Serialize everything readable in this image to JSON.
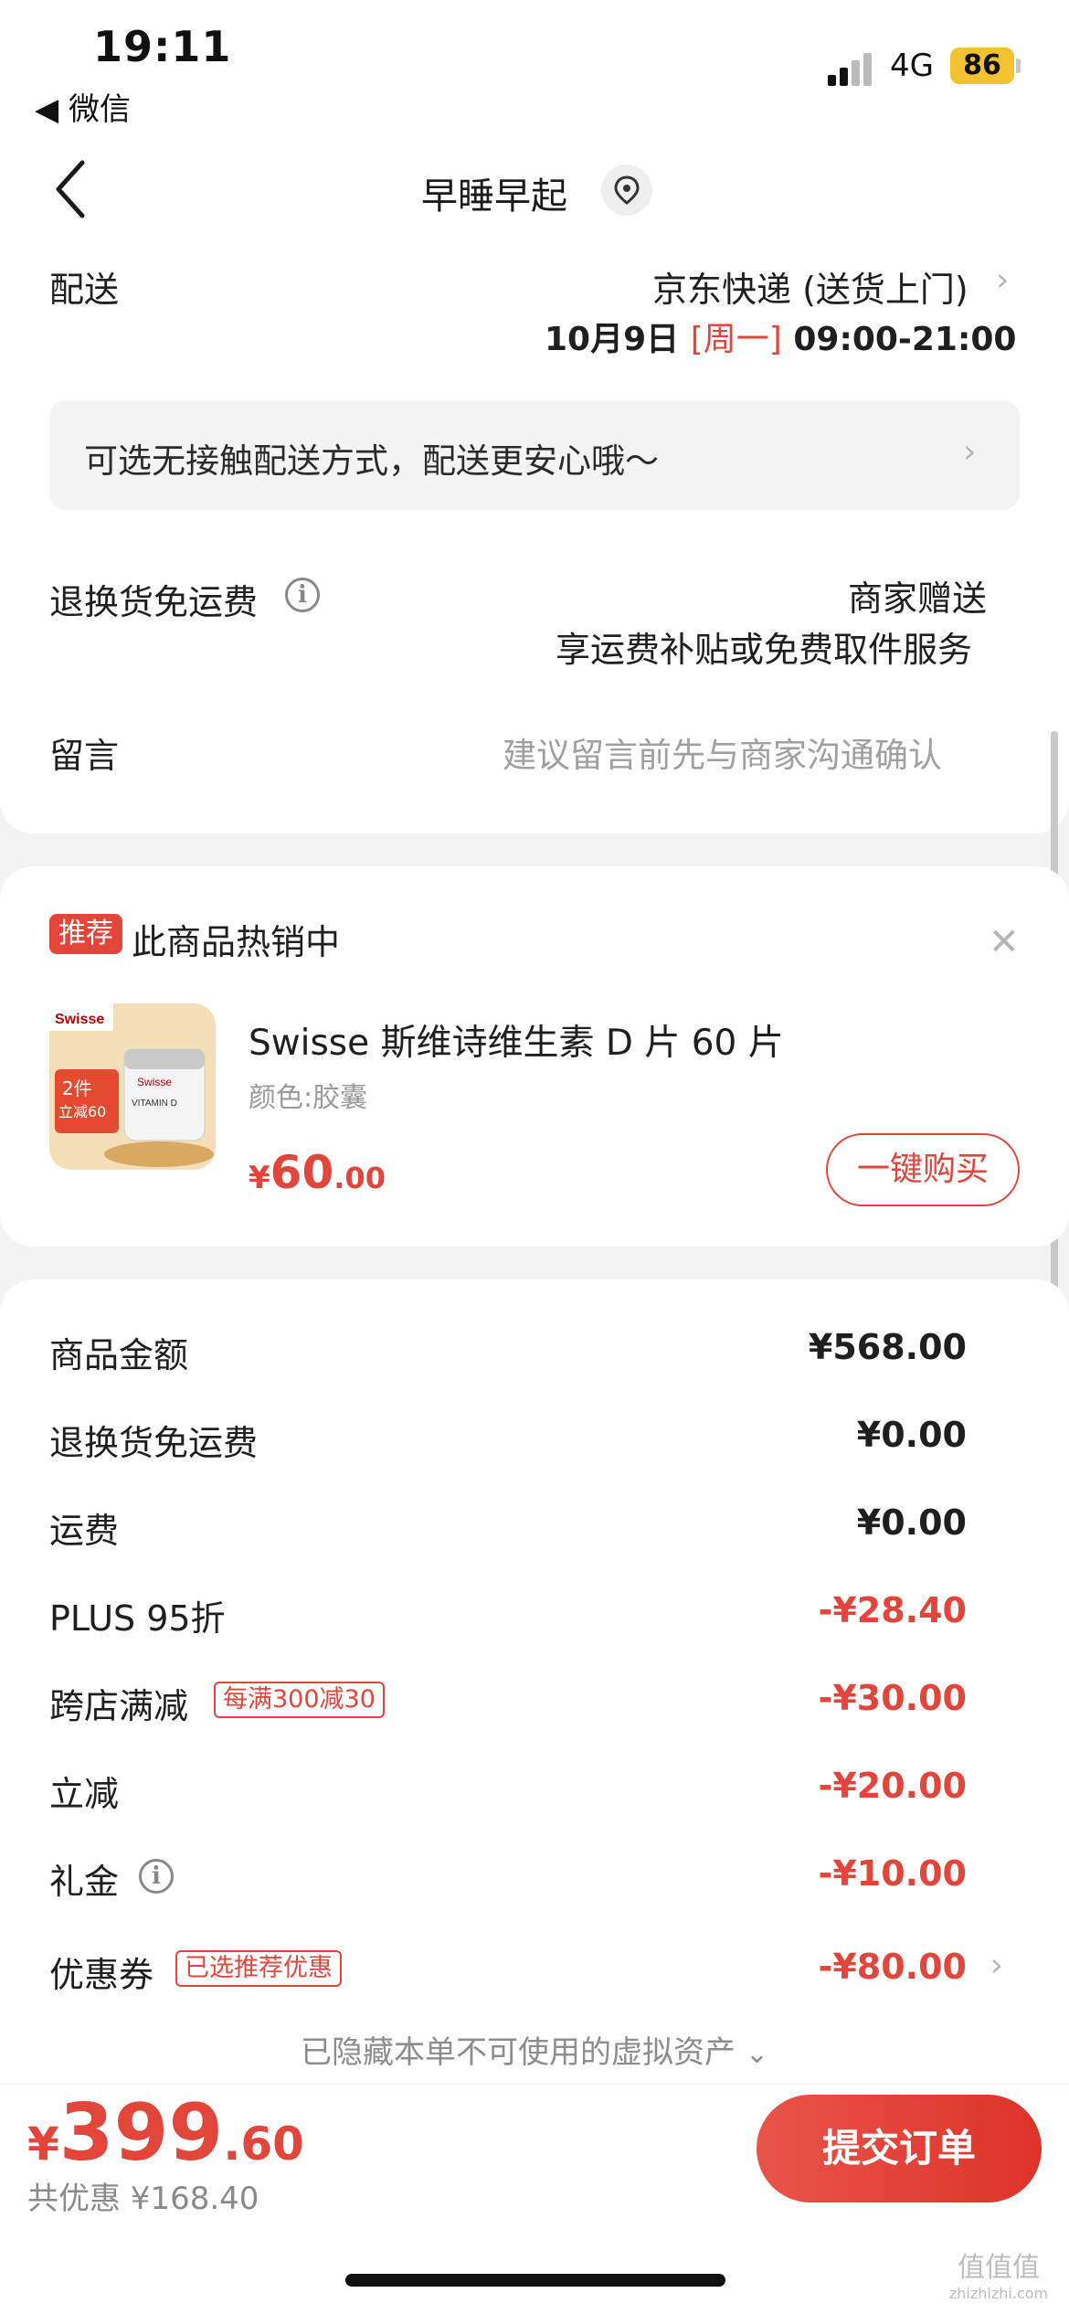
{
  "status_bar": {
    "time": "19:11",
    "back_app": "◀ 微信",
    "network": "4G",
    "battery": "86"
  },
  "header": {
    "title": "早睡早起"
  },
  "delivery": {
    "label": "配送",
    "method": "京东快递 (送货上门)",
    "date": "10月9日",
    "weekday": "[周一]",
    "time_range": "09:00-21:00",
    "tip": "可选无接触配送方式，配送更安心哦～"
  },
  "return_shipping": {
    "label": "退换货免运费",
    "value_line1": "商家赠送",
    "value_line2": "享运费补贴或免费取件服务"
  },
  "message": {
    "label": "留言",
    "placeholder": "建议留言前先与商家沟通确认"
  },
  "recommend": {
    "tag": "推荐",
    "title": "此商品热销中",
    "product_name": "Swisse 斯维诗维生素 D 片 60 片",
    "spec": "颜色:胶囊",
    "price_symbol": "¥",
    "price_int": "60",
    "price_dec": ".00",
    "buy_label": "一键购买",
    "thumb_brand": "Swisse",
    "thumb_badge_line1": "2件",
    "thumb_badge_line2": "立减60",
    "thumb_bottle_brand": "Swisse",
    "thumb_bottle_label": "VITAMIN D"
  },
  "amounts": [
    {
      "label": "商品金额",
      "value": "¥568.00",
      "red": false
    },
    {
      "label": "退换货免运费",
      "value": "¥0.00",
      "red": false
    },
    {
      "label": "运费",
      "value": "¥0.00",
      "red": false
    },
    {
      "label": "PLUS 95折",
      "value": "-¥28.40",
      "red": true
    },
    {
      "label": "跨店满减",
      "tag": "每满300减30",
      "value": "-¥30.00",
      "red": true
    },
    {
      "label": "立减",
      "value": "-¥20.00",
      "red": true
    },
    {
      "label": "礼金",
      "value": "-¥10.00",
      "red": true
    },
    {
      "label": "优惠券",
      "tag": "已选推荐优惠",
      "value": "-¥80.00",
      "red": true
    }
  ],
  "hidden_note": "已隐藏本单不可使用的虚拟资产",
  "footer": {
    "symbol": "¥",
    "total_int": "399",
    "total_dec": ".60",
    "saved": "共优惠 ¥168.40",
    "submit": "提交订单"
  },
  "watermark": {
    "text": "值值值",
    "url": "zhizhizhi.com"
  },
  "colors": {
    "accent": "#e2463b",
    "battery": "#f2c230"
  }
}
